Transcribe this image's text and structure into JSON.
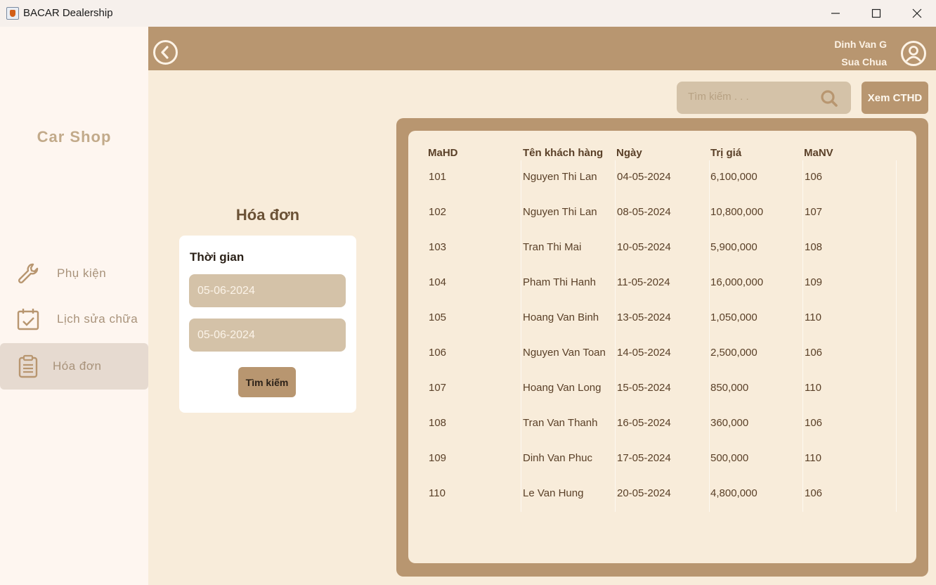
{
  "window": {
    "title": "BACAR Dealership"
  },
  "sidebar": {
    "brand": "Car Shop",
    "items": [
      {
        "label": "Phụ kiện",
        "icon": "wrench-icon"
      },
      {
        "label": "Lịch sửa chữa",
        "icon": "calendar-check-icon"
      },
      {
        "label": "Hóa đơn",
        "icon": "clipboard-icon",
        "active": true
      }
    ]
  },
  "header": {
    "user_name": "Dinh Van G",
    "user_role": "Sua Chua"
  },
  "search": {
    "placeholder": "Tìm kiếm . . .",
    "value": ""
  },
  "toolbar": {
    "detail_label": "Xem CTHD"
  },
  "page_title": "Hóa đơn",
  "filter": {
    "label": "Thời gian",
    "date_from": "05-06-2024",
    "date_to": "05-06-2024",
    "search_label": "Tìm kiếm"
  },
  "table": {
    "columns": [
      "MaHD",
      "Tên khách hàng",
      "Ngày",
      "Trị giá",
      "MaNV"
    ],
    "rows": [
      [
        "101",
        "Nguyen Thi Lan",
        "04-05-2024",
        "6,100,000",
        "106"
      ],
      [
        "102",
        "Nguyen Thi Lan",
        "08-05-2024",
        "10,800,000",
        "107"
      ],
      [
        "103",
        "Tran Thi Mai",
        "10-05-2024",
        "5,900,000",
        "108"
      ],
      [
        "104",
        "Pham Thi Hanh",
        "11-05-2024",
        "16,000,000",
        "109"
      ],
      [
        "105",
        "Hoang Van Binh",
        "13-05-2024",
        "1,050,000",
        "110"
      ],
      [
        "106",
        "Nguyen Van Toan",
        "14-05-2024",
        "2,500,000",
        "106"
      ],
      [
        "107",
        "Hoang Van Long",
        "15-05-2024",
        "850,000",
        "110"
      ],
      [
        "108",
        "Tran Van Thanh",
        "16-05-2024",
        "360,000",
        "106"
      ],
      [
        "109",
        "Dinh Van Phuc",
        "17-05-2024",
        "500,000",
        "110"
      ],
      [
        "110",
        "Le Van Hung",
        "20-05-2024",
        "4,800,000",
        "106"
      ]
    ]
  },
  "colors": {
    "accent": "#b89670",
    "background": "#f8ecda",
    "sidebar": "#fef6f0",
    "field": "#d4c2a8"
  }
}
